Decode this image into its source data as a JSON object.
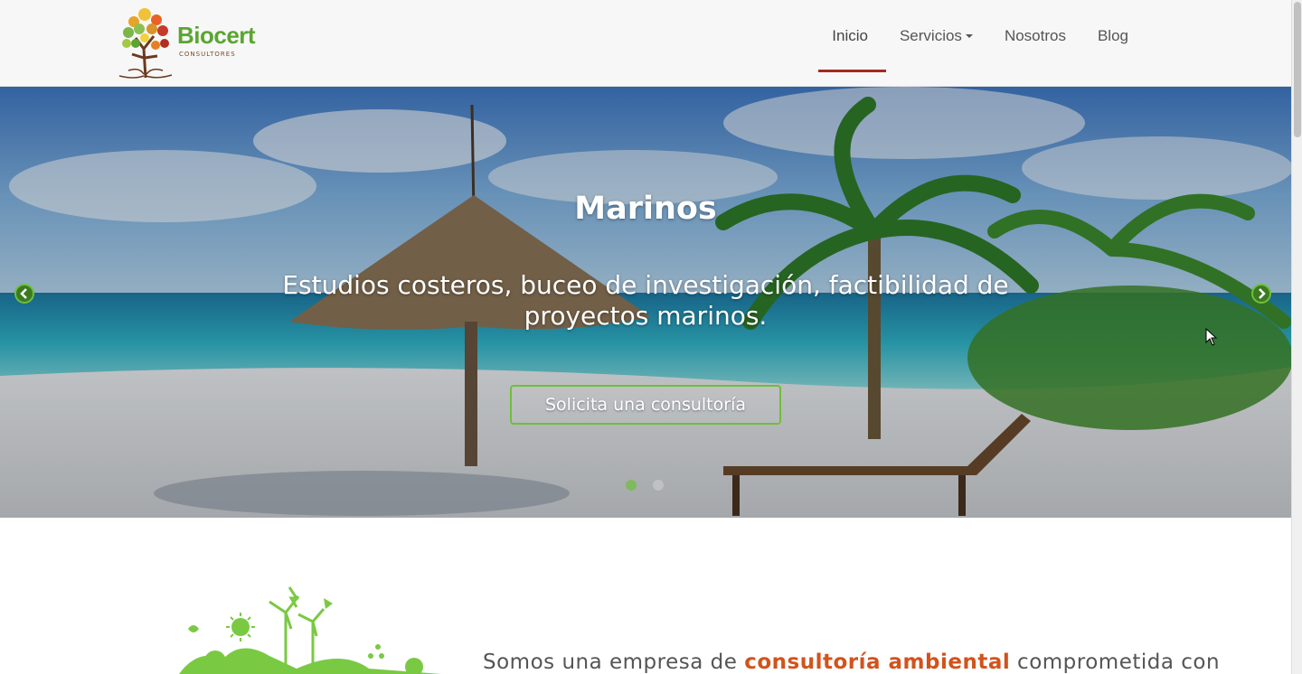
{
  "brand": {
    "name": "Biocert",
    "tagline": "CONSULTORES"
  },
  "nav": {
    "items": [
      {
        "label": "Inicio",
        "active": true
      },
      {
        "label": "Servicios",
        "dropdown": true
      },
      {
        "label": "Nosotros"
      },
      {
        "label": "Blog"
      }
    ]
  },
  "hero": {
    "title": "Marinos",
    "description": "Estudios costeros, buceo de investigación, factibilidad de proyectos marinos.",
    "button_label": "Solicita una consultoría",
    "slides_count": 2,
    "active_slide": 1
  },
  "intro": {
    "text_before": "Somos una empresa de ",
    "highlight": "consultoría ambiental",
    "text_after": " comprometida con"
  },
  "colors": {
    "brand_green": "#5ba532",
    "accent_green": "#6fbf3a",
    "nav_active_underline": "#a32a22",
    "highlight_orange": "#d2531b"
  }
}
